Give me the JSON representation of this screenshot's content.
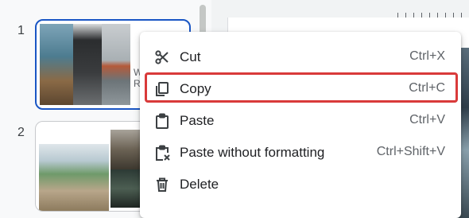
{
  "filmstrip": {
    "slides": [
      {
        "number": "1",
        "title_fragment_1": "W",
        "title_fragment_2": "RO"
      },
      {
        "number": "2"
      }
    ]
  },
  "context_menu": {
    "items": [
      {
        "label": "Cut",
        "shortcut": "Ctrl+X",
        "icon": "scissors-icon"
      },
      {
        "label": "Copy",
        "shortcut": "Ctrl+C",
        "icon": "copy-icon",
        "highlighted": true
      },
      {
        "label": "Paste",
        "shortcut": "Ctrl+V",
        "icon": "clipboard-icon"
      },
      {
        "label": "Paste without formatting",
        "shortcut": "Ctrl+Shift+V",
        "icon": "clipboard-clear-icon"
      },
      {
        "label": "Delete",
        "shortcut": "",
        "icon": "trash-icon"
      }
    ]
  },
  "colors": {
    "selected_border": "#1a56c4",
    "highlight_border": "#d93a3a",
    "menu_text": "#202124",
    "shortcut_text": "#5f6368"
  }
}
